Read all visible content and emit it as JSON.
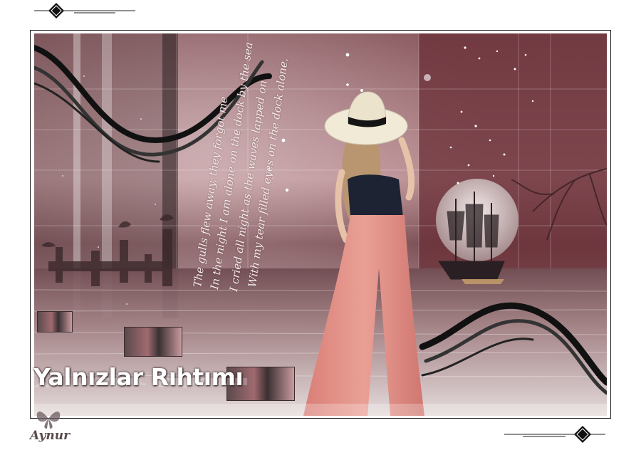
{
  "poem": {
    "lines": [
      "The gulls flew away, they forgot me",
      "In the night I am alone on the dock by the sea",
      "I cried all night as the waves lapped on",
      "With my tear filled eyes on the dock alone."
    ]
  },
  "title": "Yalnızlar Rıhtımı",
  "signature": "Aynur"
}
